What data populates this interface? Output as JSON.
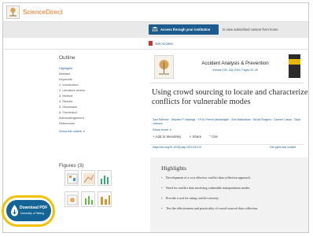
{
  "header": {
    "brand": "ScienceDirect"
  },
  "access": {
    "button_label": "Access through your institution",
    "text": "to view subscribed content from home",
    "get_access": "Get Access"
  },
  "outline": {
    "title": "Outline",
    "items": [
      "Highlights",
      "Abstract",
      "Keywords",
      "1. Introduction",
      "2. Literature review",
      "3. Method",
      "4. Results",
      "5. Discussion",
      "6. Conclusion",
      "Acknowledgement",
      "References"
    ],
    "show_full": "Show full outline ∨"
  },
  "figures": {
    "title": "Figures (3)"
  },
  "journal": {
    "title": "Accident Analysis & Prevention",
    "volume": "Volume 128, July 2019, Pages 32–39"
  },
  "article": {
    "title": "Using crowd sourcing to locate and characterize conflicts for vulnerable modes",
    "authors": "Zaur Rahman · Stephen P. Hastings · Y.P.M. Perera Vamasinghe · Zoin Madhatram · Nicola Rodgers · Carmen Casau · Tayla Johnson",
    "show_more": "Show more ∨",
    "actions": [
      "+ Add to Mendeley",
      "< Share",
      "” Cite"
    ],
    "doi": "https://doi.org/10.1016/j.aap.2019.03.014",
    "rights": "Get rights and content"
  },
  "highlights": {
    "title": "Highlights",
    "items": [
      "Development of a cost effective conflict data collection approach.",
      "Need for conflict data involving vulnerable transportation modes.",
      "Provide a tool for rating conflict severity.",
      "Test the effectiveness and practicality of crowd sourced data collection."
    ]
  },
  "download": {
    "label": "Download PDF",
    "sub": "University of Stirling"
  },
  "colors": {
    "brand": "#e9711c",
    "link": "#1c5c8e",
    "button": "#156496",
    "halo": "#f2c200"
  }
}
